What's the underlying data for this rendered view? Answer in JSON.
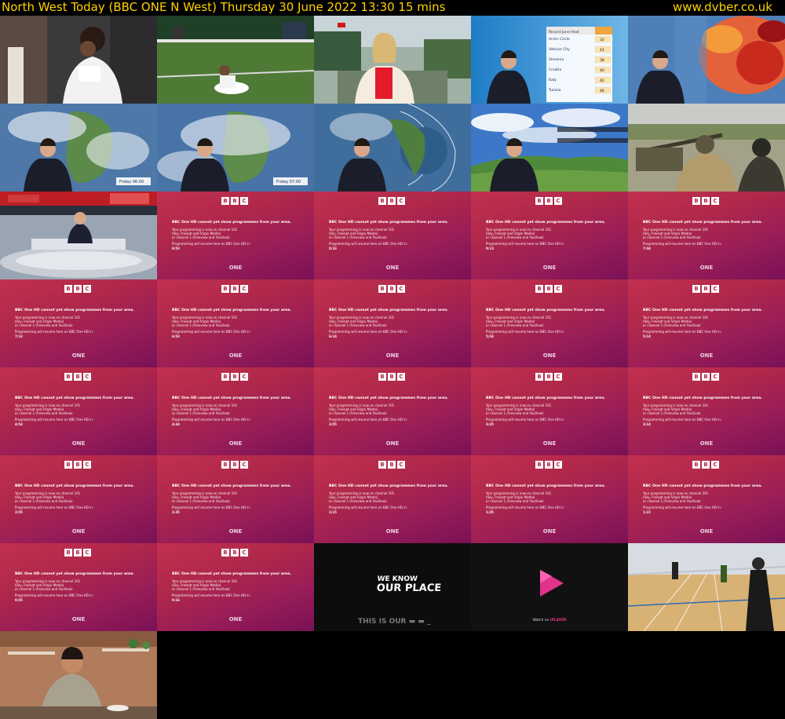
{
  "header": {
    "title": "North West Today (BBC ONE N West)    Thursday 30 June 2022  13:30  15 mins",
    "site": "www.dvber.co.uk"
  },
  "card_text": {
    "logo": [
      "B",
      "B",
      "C"
    ],
    "heading": "BBC One HD cannot yet show programmes from your area.",
    "line1": "Your programming is now on channel 101",
    "line2": "(Sky, Freesat and Virgin Media)",
    "line3": "or channel 1 (Freeview and YouView)",
    "line4": "Programming will resume here on BBC One HD in:",
    "channel": "ONE"
  },
  "countdowns": [
    "8:53",
    "8:33",
    "8:13",
    "7:34",
    "7:13",
    "6:53",
    "6:14",
    "5:54",
    "5:14",
    "4:54",
    "4:34",
    "3:55",
    "3:35",
    "3:14",
    "2:55",
    "2:35",
    "2:15",
    "1:35",
    "1:15",
    "0:55",
    "0:16"
  ],
  "promo": {
    "headline_1": "WE KNOW",
    "headline_2": "OUR PLACE",
    "tagline": "THIS IS OUR"
  },
  "iplayer": {
    "text": "Watch on",
    "brand": "iPLAYER"
  },
  "weather_table": {
    "title": "Record June Heat",
    "rows": [
      {
        "place": "Arctic Circle",
        "value": "33"
      },
      {
        "place": "Vatican City",
        "value": "41"
      },
      {
        "place": "Slovenia",
        "value": "38"
      },
      {
        "place": "Croatia",
        "value": "40"
      },
      {
        "place": "Italy",
        "value": "42"
      },
      {
        "place": "Tunisia",
        "value": "46"
      }
    ]
  },
  "map_labels": [
    "Friday 06:00",
    "Friday 07:00"
  ],
  "colors": {
    "header_text": "#ffd200",
    "card_top": "#c2304f",
    "card_bottom": "#7a1156",
    "iplayer": "#e23a8e"
  }
}
